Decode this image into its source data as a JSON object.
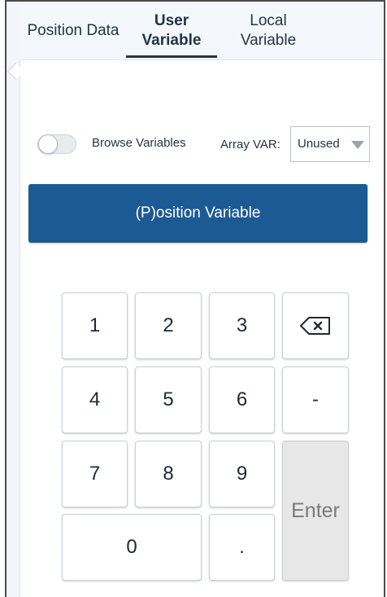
{
  "tabs": [
    {
      "label": "Position Data"
    },
    {
      "label": "User\nVariable"
    },
    {
      "label": "Local\nVariable"
    }
  ],
  "active_tab": "User Variable",
  "browse": {
    "label": "Browse Variables",
    "toggle_on": false
  },
  "array_var": {
    "label": "Array VAR:",
    "selected": "Unused"
  },
  "position_variable_button": "(P)osition Variable",
  "keypad": {
    "k1": "1",
    "k2": "2",
    "k3": "3",
    "k4": "4",
    "k5": "5",
    "k6": "6",
    "k7": "7",
    "k8": "8",
    "k9": "9",
    "k0": "0",
    "dot": ".",
    "minus": "-",
    "enter": "Enter",
    "backspace_icon": "backspace-icon"
  },
  "colors": {
    "primary": "#1c5a93",
    "tab_bg": "#f4f8fc",
    "enter_bg": "#e7e7e7"
  }
}
